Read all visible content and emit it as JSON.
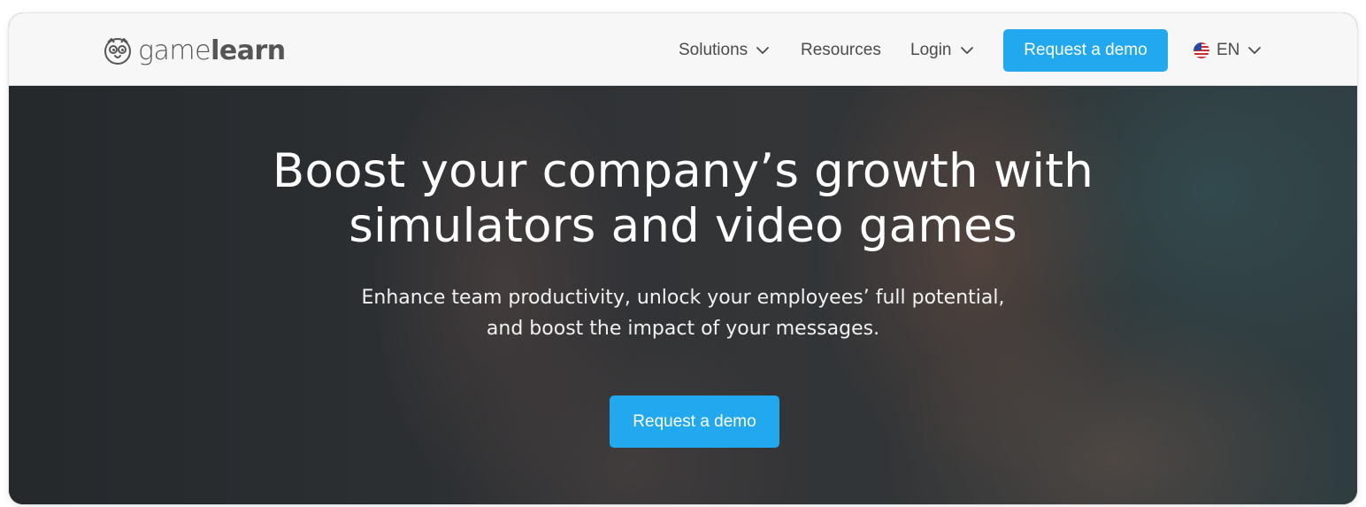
{
  "brand": {
    "name_light": "game",
    "name_bold": "learn",
    "logo_icon": "owl-face-icon"
  },
  "nav": {
    "solutions": {
      "label": "Solutions",
      "icon": "chevron-down-icon"
    },
    "resources": {
      "label": "Resources"
    },
    "login": {
      "label": "Login",
      "icon": "chevron-down-icon"
    },
    "cta": "Request a demo",
    "language": {
      "label": "EN",
      "flag_icon": "us-flag-icon",
      "icon": "chevron-down-icon"
    }
  },
  "hero": {
    "title_line1": "Boost your company’s growth with",
    "title_line2": "simulators and video games",
    "subtitle_line1": "Enhance team productivity, unlock your employees’ full potential,",
    "subtitle_line2": "and boost the impact of your messages.",
    "cta": "Request a demo"
  },
  "colors": {
    "accent": "#22a8ee",
    "header_bg": "#f7f7f7",
    "nav_text": "#4b4b4b",
    "hero_text": "#ffffff"
  }
}
